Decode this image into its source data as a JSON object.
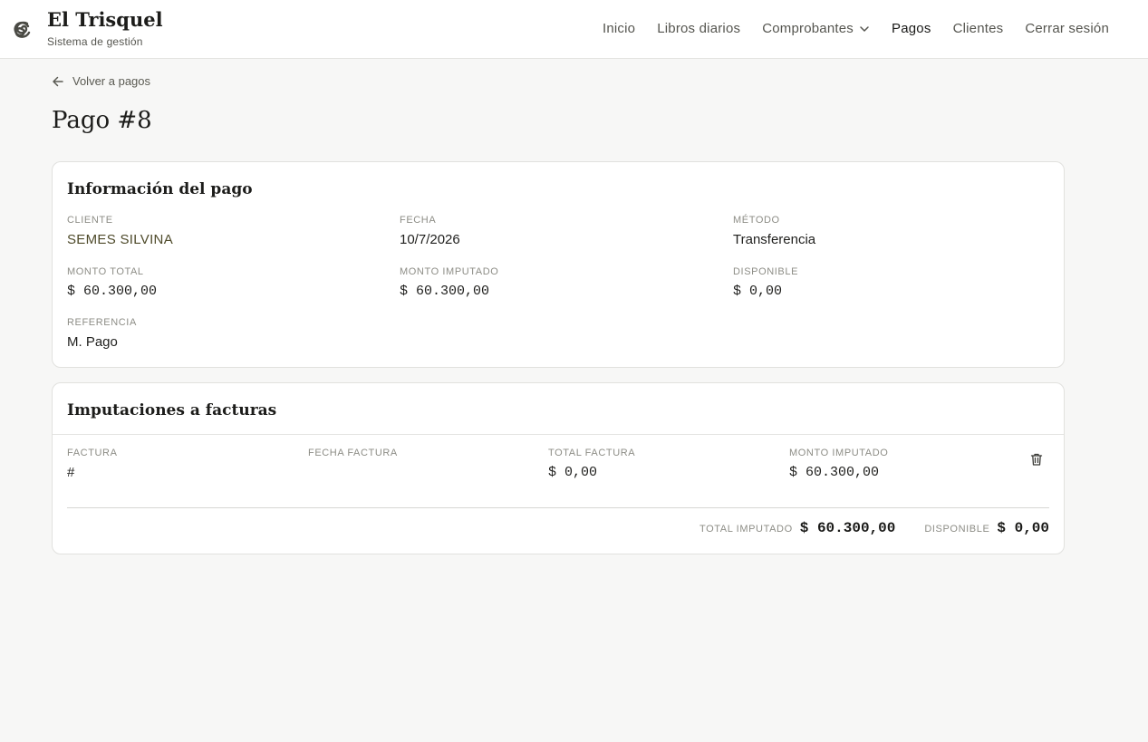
{
  "header": {
    "title": "El Trisquel",
    "subtitle": "Sistema de gestión",
    "nav": {
      "inicio": "Inicio",
      "libros": "Libros diarios",
      "comprobantes": "Comprobantes",
      "pagos": "Pagos",
      "clientes": "Clientes",
      "logout": "Cerrar sesión"
    },
    "icons": {
      "logo": "spiral-logo-icon",
      "dropdown": "chevron-down-icon"
    }
  },
  "back_link": {
    "label": "Volver a pagos",
    "icon": "arrow-left-icon"
  },
  "page_title": "Pago #8",
  "info": {
    "title": "Información del pago",
    "cliente_label": "CLIENTE",
    "cliente_value": "SEMES SILVINA",
    "fecha_label": "FECHA",
    "fecha_value": "10/7/2026",
    "metodo_label": "MÉTODO",
    "metodo_value": "Transferencia",
    "monto_total_label": "MONTO TOTAL",
    "monto_total_value": "$ 60.300,00",
    "monto_imputado_label": "MONTO IMPUTADO",
    "monto_imputado_value": "$ 60.300,00",
    "disponible_label": "DISPONIBLE",
    "disponible_value": "$ 0,00",
    "referencia_label": "REFERENCIA",
    "referencia_value": "M. Pago"
  },
  "imputaciones": {
    "title": "Imputaciones a facturas",
    "columns": [
      "FACTURA",
      "FECHA FACTURA",
      "TOTAL FACTURA",
      "MONTO IMPUTADO"
    ],
    "rows": [
      {
        "factura": "#",
        "fecha": "",
        "total": "$ 0,00",
        "monto": "$ 60.300,00",
        "action_icon": "trash-icon"
      }
    ],
    "total_imputado_label": "TOTAL IMPUTADO",
    "total_imputado_value": "$ 60.300,00",
    "disponible_label": "DISPONIBLE",
    "disponible_value": "$ 0,00"
  },
  "colors": {
    "background": "#f7f7f6",
    "card": "#ffffff",
    "accent_text": "#4e4a2a",
    "muted": "#8d8d86"
  }
}
